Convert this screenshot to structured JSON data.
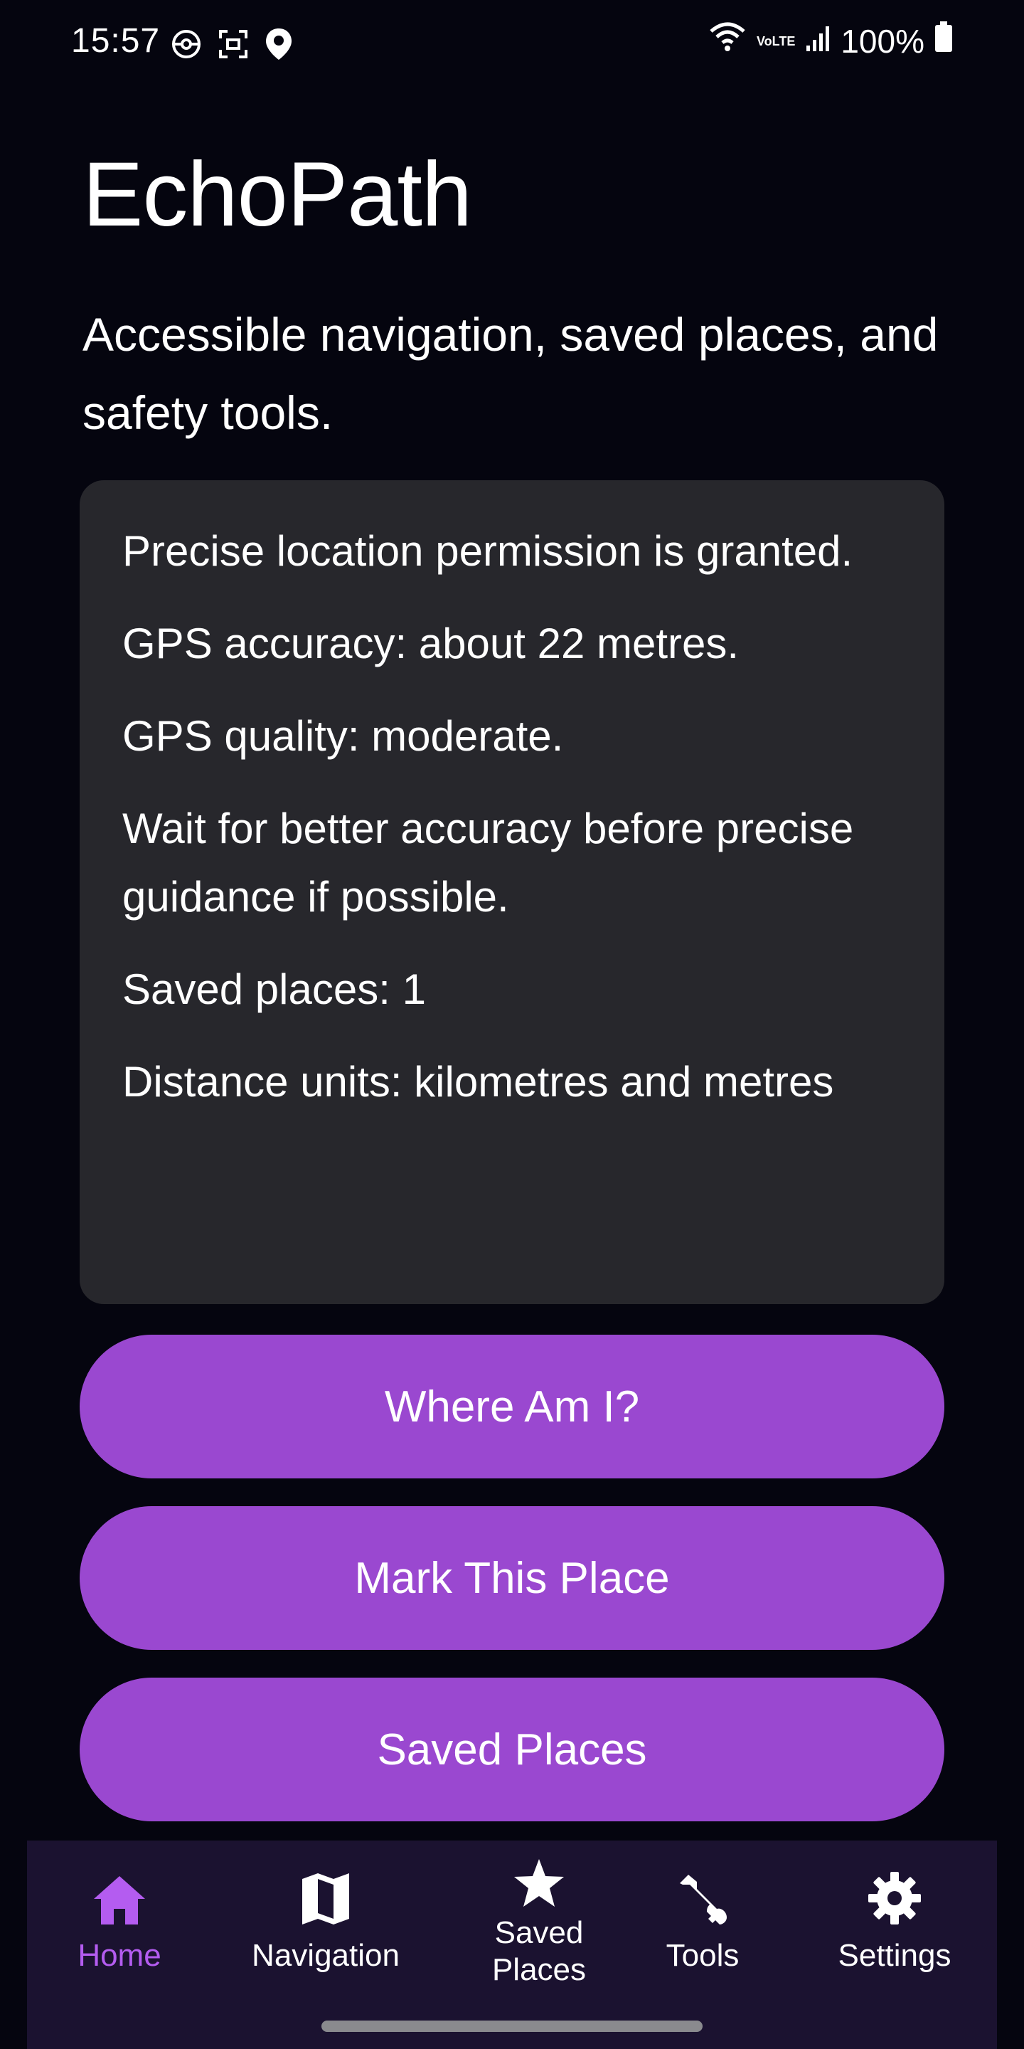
{
  "status_bar": {
    "time": "15:57",
    "network": "VoLTE",
    "battery": "100%",
    "left_icons": [
      "sync-icon",
      "screenshot-icon",
      "location-pin-icon"
    ],
    "right_icons": [
      "wifi-icon",
      "signal-icon",
      "battery-icon"
    ]
  },
  "header": {
    "title": "EchoPath",
    "subtitle": "Accessible navigation, saved places, and safety tools."
  },
  "info_card": {
    "lines": [
      "Precise location permission is granted.",
      "GPS accuracy: about 22 metres.",
      "GPS quality: moderate.",
      "Wait for better accuracy before precise guidance if possible.",
      "Saved places: 1",
      "Distance units: kilometres and metres"
    ]
  },
  "actions": {
    "where_am_i": "Where Am I?",
    "mark_place": "Mark This Place",
    "saved_places": "Saved Places"
  },
  "bottom_nav": {
    "items": [
      {
        "label": "Home",
        "icon": "home-icon",
        "active": true
      },
      {
        "label": "Navigation",
        "icon": "map-icon",
        "active": false
      },
      {
        "label": "Saved Places",
        "icon": "star-icon",
        "active": false
      },
      {
        "label": "Tools",
        "icon": "wrench-icon",
        "active": false
      },
      {
        "label": "Settings",
        "icon": "gear-icon",
        "active": false
      }
    ]
  },
  "colors": {
    "background": "#05050f",
    "card": "#27272c",
    "accent": "#9a48d0",
    "nav_active": "#b45cf0",
    "nav_background": "#1b1230"
  }
}
